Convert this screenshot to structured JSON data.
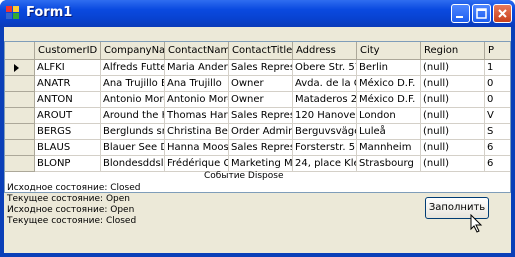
{
  "window": {
    "title": "Form1"
  },
  "grid": {
    "columns": [
      "CustomerID",
      "CompanyNa",
      "ContactName",
      "ContactTitle",
      "Address",
      "City",
      "Region",
      "P"
    ],
    "rows": [
      [
        "ALFKI",
        "Alfreds Futter",
        "Maria Anders",
        "Sales Repres",
        "Obere Str. 57",
        "Berlin",
        "(null)",
        "1"
      ],
      [
        "ANATR",
        "Ana Trujillo E",
        "Ana Trujillo",
        "Owner",
        "Avda. de la C",
        "México D.F.",
        "(null)",
        "0"
      ],
      [
        "ANTON",
        "Antonio More",
        "Antonio More",
        "Owner",
        "Mataderos 2",
        "México D.F.",
        "(null)",
        "0"
      ],
      [
        "AROUT",
        "Around the H",
        "Thomas Hard",
        "Sales Repres",
        "120 Hanover",
        "London",
        "(null)",
        "V"
      ],
      [
        "BERGS",
        "Berglunds sn",
        "Christina Ber",
        "Order Admini",
        "Berguvsvägen",
        "Luleå",
        "(null)",
        "S"
      ],
      [
        "BLAUS",
        "Blauer See D",
        "Hanna Moos",
        "Sales Repres",
        "Forsterstr. 57",
        "Mannheim",
        "(null)",
        "6"
      ],
      [
        "BLONP",
        "Blondesddsl",
        "Frédérique Ci",
        "Marketing Ma",
        "24, place Klé",
        "Strasbourg",
        "(null)",
        "6"
      ]
    ]
  },
  "event_label": "Событие Dispose",
  "log": [
    "Исходное состояние: Closed",
    "Текущее состояние: Open",
    "Исходное состояние: Open",
    "Текущее состояние: Closed"
  ],
  "fill_button": "Заполнить"
}
